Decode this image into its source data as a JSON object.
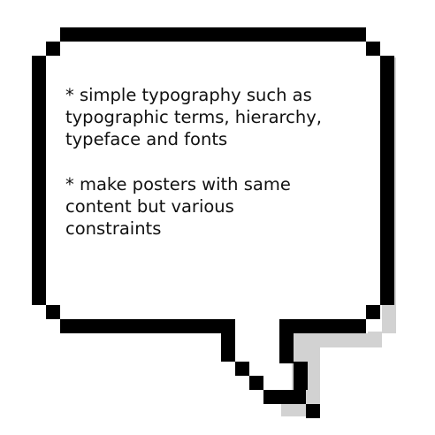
{
  "bubble": {
    "paragraphs": [
      "* simple typography such as\ntypographic terms, hierarchy,\ntypeface and fonts",
      "* make posters with same\ncontent but various\nconstraints"
    ]
  },
  "colors": {
    "outline": "#000000",
    "shadow": "#d2d2d2",
    "fill": "#ffffff",
    "text": "#111111"
  }
}
